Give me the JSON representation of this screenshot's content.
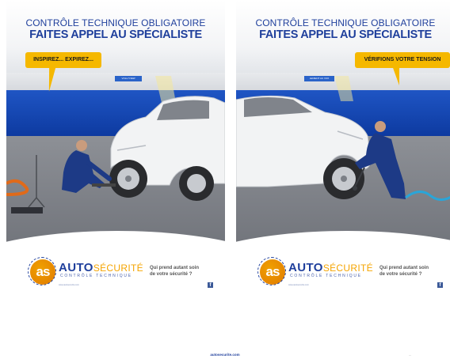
{
  "posters": [
    {
      "headline_line1": "CONTRÔLE TECHNIQUE OBLIGATOIRE",
      "headline_line2": "FAITES APPEL AU SPÉCIALISTE",
      "bubble": "INSPIREZ... EXPIREZ...",
      "sign": "VOLLYVIEW",
      "brand_main": "AUTO",
      "brand_accent": "SÉCURITÉ",
      "brand_sub": "CONTRÔLE TECHNIQUE",
      "badge": "as",
      "legal": "www.autosecurite.com",
      "tagline_line1": "Qui prend autant soin",
      "tagline_line2": "de votre sécurité ?",
      "social_icon": "facebook-icon"
    },
    {
      "headline_line1": "CONTRÔLE TECHNIQUE OBLIGATOIRE",
      "headline_line2": "FAITES APPEL AU SPÉCIALISTE",
      "bubble": "VÉRIFIONS VOTRE TENSION",
      "sign": "LENIENT AU VOX",
      "brand_main": "AUTO",
      "brand_accent": "SÉCURITÉ",
      "brand_sub": "CONTRÔLE TECHNIQUE",
      "badge": "as",
      "legal": "www.autosecurite.com",
      "tagline_line1": "Qui prend autant soin",
      "tagline_line2": "de votre sécurité ?",
      "social_icon": "facebook-icon"
    }
  ],
  "footer": {
    "link": "autosecurite.com",
    "mark": "..."
  },
  "colors": {
    "brand_blue": "#1f3f9c",
    "accent_yellow": "#f5b800",
    "wall_blue": "#1247b5"
  }
}
